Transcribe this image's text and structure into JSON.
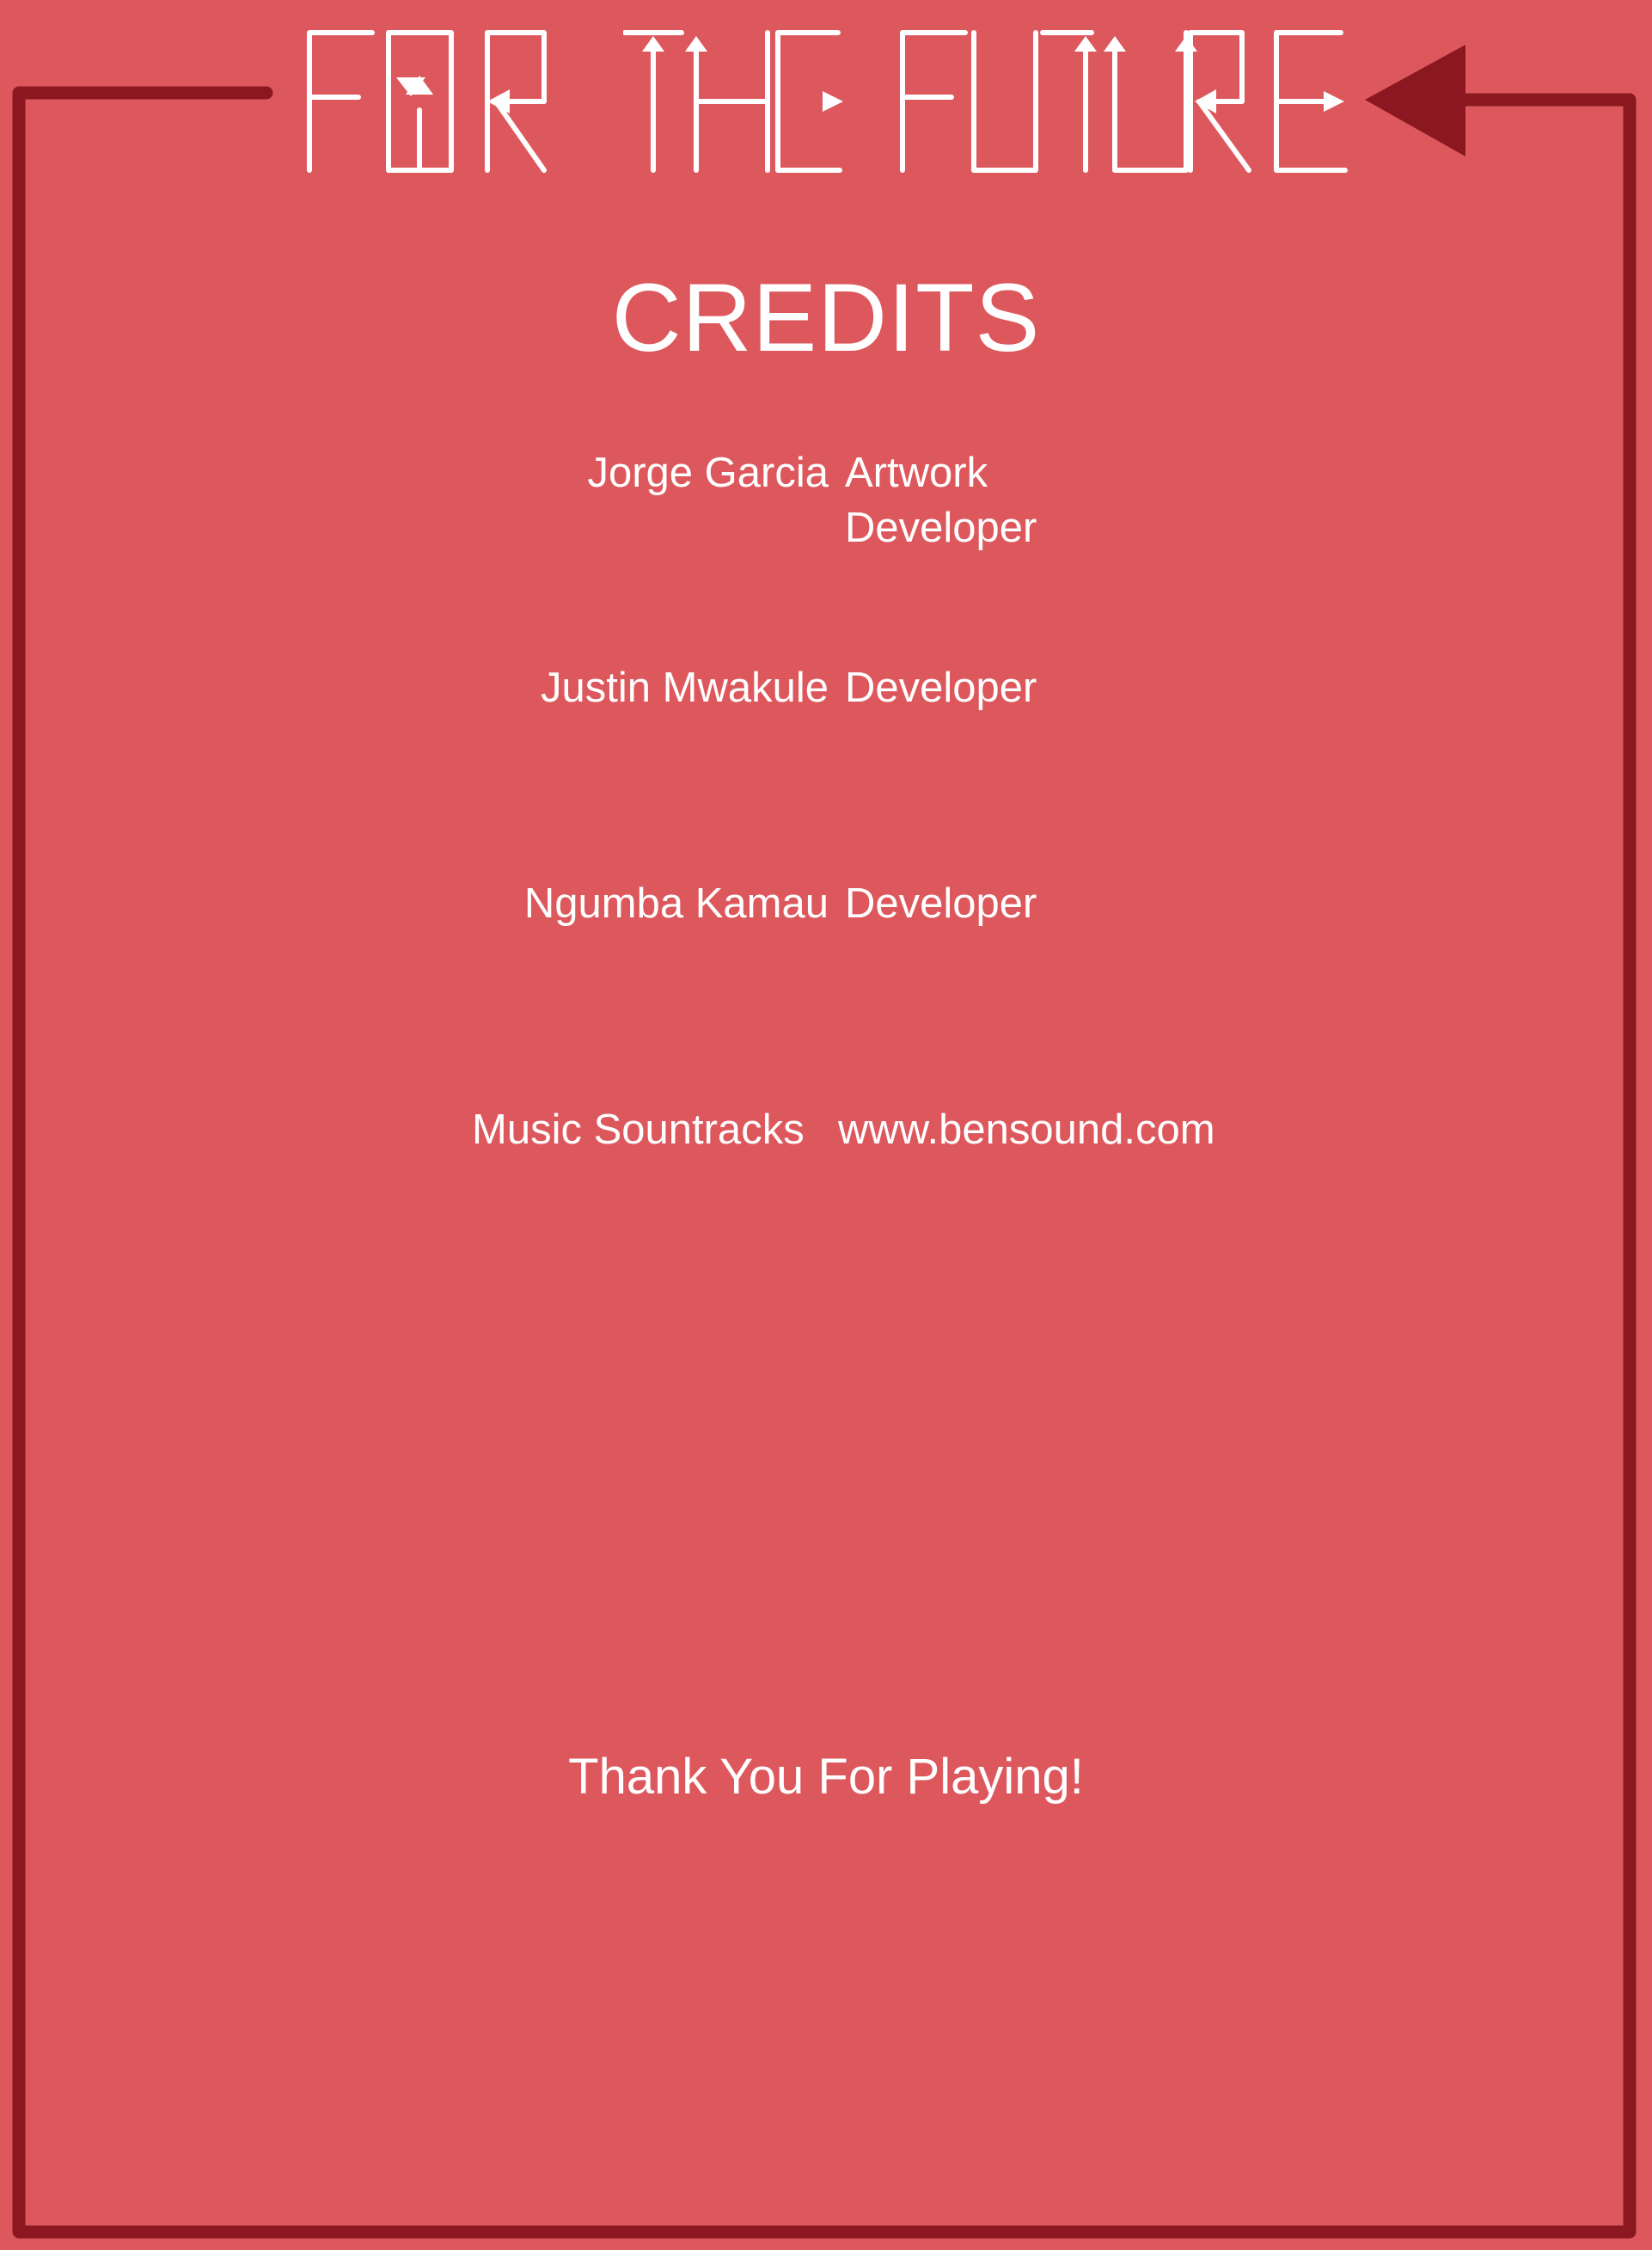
{
  "logo": {
    "text": "FOR THE FUTURE",
    "words": [
      "FOR",
      "THE",
      "FUTURE"
    ]
  },
  "heading": "CREDITS",
  "credits": [
    {
      "name": "Jorge Garcia",
      "roles": [
        "Artwork",
        "Developer"
      ]
    },
    {
      "name": "Justin Mwakule",
      "roles": [
        "Developer"
      ]
    },
    {
      "name": "Ngumba Kamau",
      "roles": [
        "Developer"
      ]
    }
  ],
  "music": {
    "label": "Music Sountracks",
    "source": "www.bensound.com"
  },
  "closing": "Thank You For Playing!",
  "colors": {
    "background": "#dd585d",
    "frame": "#8b1820",
    "text": "#ffffff"
  }
}
